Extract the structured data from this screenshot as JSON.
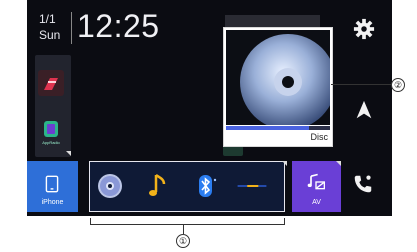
{
  "clock": {
    "month_day": "1/1",
    "weekday": "Sun",
    "time": "12:25"
  },
  "home_button": {
    "label": "iPhone"
  },
  "apps": [
    {
      "label": "AppRadio",
      "icon": "appradio-icon"
    }
  ],
  "sources": [
    {
      "name": "disc-source-icon"
    },
    {
      "name": "music-note-icon"
    },
    {
      "name": "bluetooth-icon"
    },
    {
      "name": "aux-cable-icon"
    }
  ],
  "av_button": {
    "label": "AV"
  },
  "now_playing": {
    "source_label": "Disc",
    "progress": 0.8
  },
  "callouts": {
    "source_bar": "①",
    "album": "②"
  },
  "colors": {
    "accent_blue": "#2e6fd8",
    "av_purple": "#6a3fd6",
    "background": "#0b0c12"
  }
}
